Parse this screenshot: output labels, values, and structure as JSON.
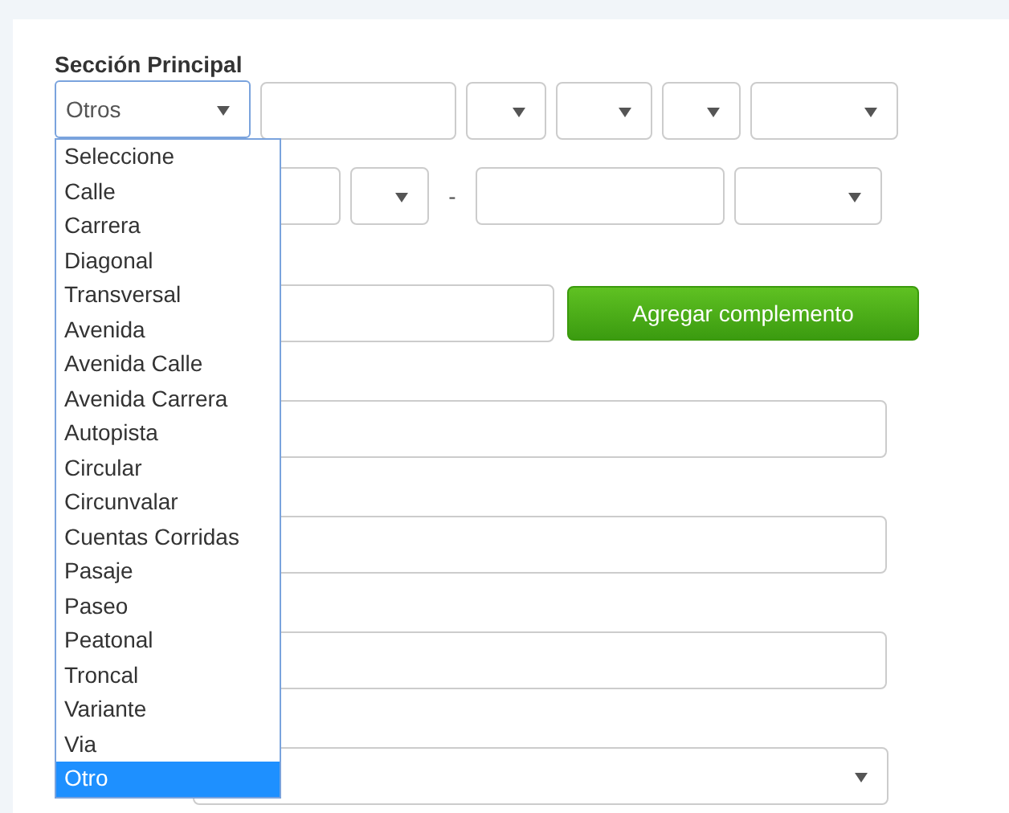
{
  "section_title": "Sección Principal",
  "main_select": {
    "value": "Otros",
    "options": [
      {
        "label": "Seleccione",
        "selected": false
      },
      {
        "label": "Calle",
        "selected": false
      },
      {
        "label": "Carrera",
        "selected": false
      },
      {
        "label": "Diagonal",
        "selected": false
      },
      {
        "label": "Transversal",
        "selected": false
      },
      {
        "label": "Avenida",
        "selected": false
      },
      {
        "label": "Avenida Calle",
        "selected": false
      },
      {
        "label": "Avenida Carrera",
        "selected": false
      },
      {
        "label": "Autopista",
        "selected": false
      },
      {
        "label": "Circular",
        "selected": false
      },
      {
        "label": "Circunvalar",
        "selected": false
      },
      {
        "label": "Cuentas Corridas",
        "selected": false
      },
      {
        "label": "Pasaje",
        "selected": false
      },
      {
        "label": "Paseo",
        "selected": false
      },
      {
        "label": "Peatonal",
        "selected": false
      },
      {
        "label": "Troncal",
        "selected": false
      },
      {
        "label": "Variante",
        "selected": false
      },
      {
        "label": "Via",
        "selected": false
      },
      {
        "label": "Otro",
        "selected": true
      }
    ]
  },
  "rows": [
    {
      "fields": [
        {
          "kind": "input"
        },
        {
          "kind": "select"
        },
        {
          "kind": "select"
        },
        {
          "kind": "select"
        },
        {
          "kind": "select"
        }
      ]
    },
    {
      "fields": [
        {
          "kind": "input"
        },
        {
          "kind": "select"
        },
        {
          "kind": "separator",
          "text": "-"
        },
        {
          "kind": "input"
        },
        {
          "kind": "select"
        }
      ]
    },
    {
      "fields": [
        {
          "kind": "input"
        },
        {
          "kind": "button",
          "text": "Agregar complemento"
        }
      ]
    },
    {
      "fields": [
        {
          "kind": "input"
        }
      ]
    },
    {
      "fields": [
        {
          "kind": "input"
        }
      ]
    },
    {
      "fields": [
        {
          "kind": "input"
        }
      ]
    },
    {
      "fields": [
        {
          "kind": "select"
        }
      ]
    }
  ]
}
